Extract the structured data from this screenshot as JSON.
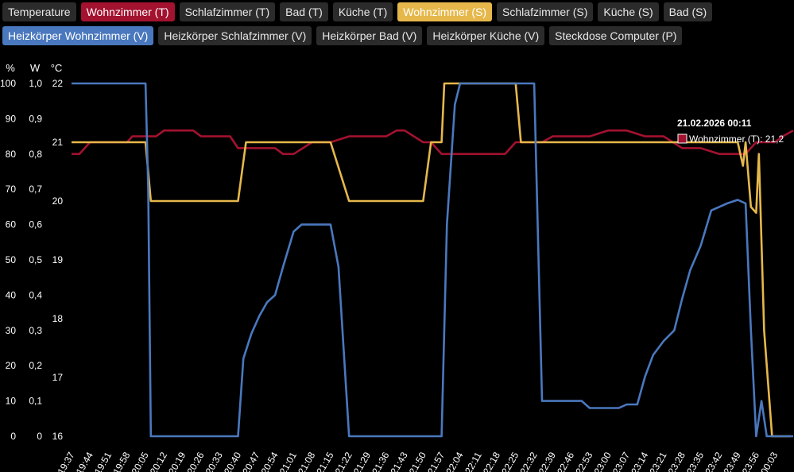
{
  "buttons_row1": [
    {
      "label": "Temperature",
      "style": "default"
    },
    {
      "label": "Wohnzimmer (T)",
      "style": "red"
    },
    {
      "label": "Schlafzimmer (T)",
      "style": "default"
    },
    {
      "label": "Bad (T)",
      "style": "default"
    },
    {
      "label": "Küche (T)",
      "style": "default"
    },
    {
      "label": "Wohnzimmer (S)",
      "style": "yellow"
    },
    {
      "label": "Schlafzimmer (S)",
      "style": "default"
    },
    {
      "label": "Küche (S)",
      "style": "default"
    },
    {
      "label": "Bad (S)",
      "style": "default"
    }
  ],
  "buttons_row2": [
    {
      "label": "Heizkörper Wohnzimmer (V)",
      "style": "blue"
    },
    {
      "label": "Heizkörper Schlafzimmer (V)",
      "style": "default"
    },
    {
      "label": "Heizkörper Bad (V)",
      "style": "default"
    },
    {
      "label": "Heizkörper Küche (V)",
      "style": "default"
    },
    {
      "label": "Steckdose Computer (P)",
      "style": "default"
    }
  ],
  "chart_data": {
    "type": "line",
    "grid": false,
    "background": "#000000",
    "x_tick_labels": [
      "19:37",
      "19:44",
      "19:51",
      "19:58",
      "20:05",
      "20:12",
      "20:19",
      "20:26",
      "20:33",
      "20:40",
      "20:47",
      "20:54",
      "21:01",
      "21:08",
      "21:15",
      "21:22",
      "21:29",
      "21:36",
      "21:43",
      "21:50",
      "21:57",
      "22:04",
      "22:11",
      "22:18",
      "22:25",
      "22:32",
      "22:39",
      "22:46",
      "22:53",
      "23:00",
      "23:07",
      "23:14",
      "23:21",
      "23:28",
      "23:35",
      "23:42",
      "23:49",
      "23:56",
      "00:03"
    ],
    "axes": {
      "percent": {
        "unit": "%",
        "ticks": [
          "100",
          "90",
          "80",
          "70",
          "60",
          "50",
          "40",
          "30",
          "20",
          "10",
          "0"
        ],
        "range": [
          0,
          100
        ]
      },
      "watt": {
        "unit": "W",
        "ticks": [
          "1,0",
          "0,9",
          "0,8",
          "0,7",
          "0,6",
          "0,5",
          "0,4",
          "0,3",
          "0,2",
          "0,1",
          "0"
        ],
        "range": [
          0,
          1
        ]
      },
      "celsius": {
        "unit": "°C",
        "ticks": [
          "22",
          "21",
          "20",
          "19",
          "18",
          "17",
          "16"
        ],
        "range": [
          16,
          22
        ]
      }
    },
    "series": [
      {
        "name": "Wohnzimmer (T)",
        "axis": "celsius",
        "color": "#a3122f",
        "x": [
          "19:37",
          "19:40",
          "19:44",
          "19:51",
          "19:58",
          "20:00",
          "20:05",
          "20:09",
          "20:12",
          "20:19",
          "20:23",
          "20:26",
          "20:33",
          "20:37",
          "20:40",
          "20:47",
          "20:54",
          "20:57",
          "21:01",
          "21:08",
          "21:11",
          "21:15",
          "21:22",
          "21:29",
          "21:36",
          "21:40",
          "21:43",
          "21:50",
          "21:53",
          "21:57",
          "22:04",
          "22:11",
          "22:18",
          "22:21",
          "22:25",
          "22:32",
          "22:35",
          "22:39",
          "22:46",
          "22:53",
          "23:00",
          "23:04",
          "23:07",
          "23:14",
          "23:21",
          "23:28",
          "23:31",
          "23:35",
          "23:42",
          "23:49",
          "23:52",
          "23:56",
          "00:03",
          "00:06",
          "00:10"
        ],
        "y": [
          20.8,
          20.8,
          21.0,
          21.0,
          21.0,
          21.1,
          21.1,
          21.1,
          21.2,
          21.2,
          21.2,
          21.1,
          21.1,
          21.1,
          20.9,
          20.9,
          20.9,
          20.8,
          20.8,
          21.0,
          21.0,
          21.0,
          21.1,
          21.1,
          21.1,
          21.2,
          21.2,
          21.0,
          21.0,
          20.8,
          20.8,
          20.8,
          20.8,
          20.8,
          21.0,
          21.0,
          21.0,
          21.1,
          21.1,
          21.1,
          21.2,
          21.2,
          21.2,
          21.1,
          21.1,
          20.9,
          20.9,
          20.9,
          20.8,
          20.8,
          20.8,
          21.0,
          21.0,
          21.1,
          21.2
        ]
      },
      {
        "name": "Wohnzimmer (S)",
        "axis": "celsius",
        "color": "#e6b84b",
        "x": [
          "19:37",
          "20:05",
          "20:05",
          "20:07",
          "20:40",
          "20:43",
          "21:15",
          "21:22",
          "21:50",
          "21:53",
          "21:57",
          "21:58",
          "22:25",
          "22:27",
          "23:49",
          "23:51",
          "23:52",
          "23:54",
          "23:56",
          "23:57",
          "23:59",
          "00:02",
          "00:03",
          "00:09"
        ],
        "y": [
          21,
          21,
          21,
          20,
          20,
          21,
          21,
          20,
          20,
          21,
          21,
          22,
          22,
          21,
          21,
          20.6,
          21,
          19.9,
          19.8,
          20.8,
          17.8,
          16,
          16,
          16
        ]
      },
      {
        "name": "Heizkörper Wohnzimmer (V)",
        "axis": "percent",
        "color": "#4a78be",
        "x": [
          "19:37",
          "20:05",
          "20:06",
          "20:07",
          "20:40",
          "20:42",
          "20:45",
          "20:48",
          "20:51",
          "20:54",
          "20:57",
          "21:01",
          "21:04",
          "21:08",
          "21:11",
          "21:15",
          "21:18",
          "21:22",
          "21:29",
          "21:43",
          "21:50",
          "21:57",
          "21:59",
          "22:02",
          "22:04",
          "22:06",
          "22:32",
          "22:35",
          "22:39",
          "22:46",
          "22:50",
          "22:53",
          "23:00",
          "23:04",
          "23:07",
          "23:11",
          "23:14",
          "23:17",
          "23:21",
          "23:25",
          "23:28",
          "23:31",
          "23:35",
          "23:39",
          "23:42",
          "23:45",
          "23:49",
          "23:52",
          "23:54",
          "23:56",
          "23:58",
          "00:00",
          "00:03",
          "00:10"
        ],
        "y": [
          100,
          100,
          70,
          0,
          0,
          22,
          29,
          34,
          38,
          40,
          48,
          58,
          60,
          60,
          60,
          60,
          48,
          0,
          0,
          0,
          0,
          0,
          60,
          94,
          100,
          100,
          100,
          10,
          10,
          10,
          10,
          8,
          8,
          8,
          9,
          9,
          17,
          23,
          27,
          30,
          39,
          47,
          54,
          64,
          65,
          66,
          67,
          66,
          30,
          0,
          10,
          0,
          0,
          0
        ]
      }
    ],
    "tooltip": {
      "title": "21.02.2026 00:11",
      "series": "Wohnzimmer (T)",
      "value": "21,2",
      "label": "Wohnzimmer (T): 21,2",
      "swatch_color": "#a3122f"
    }
  }
}
